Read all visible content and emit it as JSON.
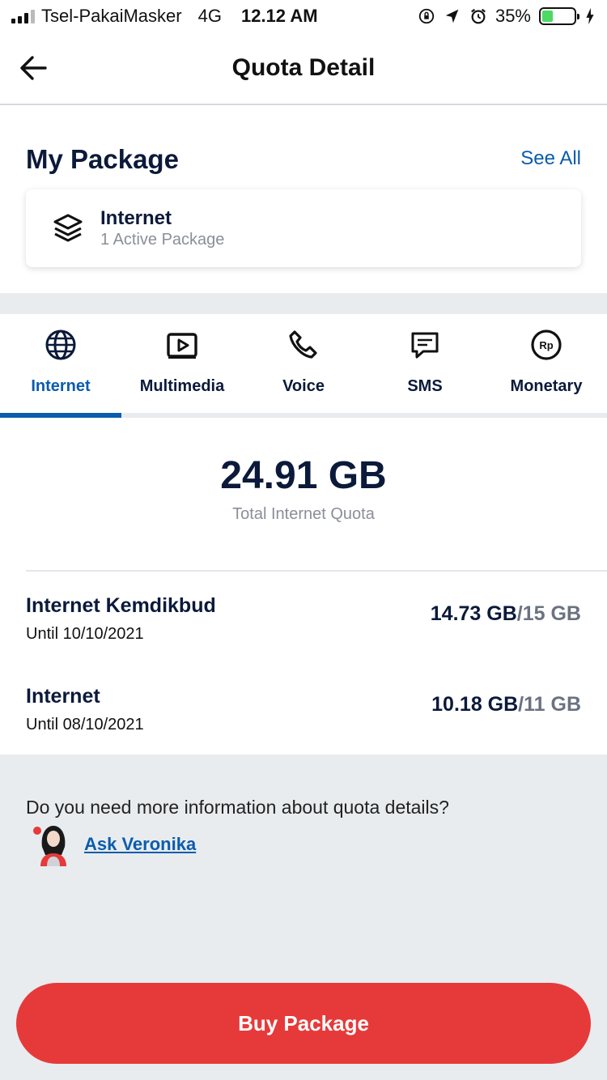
{
  "status_bar": {
    "carrier": "Tsel-PakaiMasker",
    "network": "4G",
    "time": "12.12 AM",
    "battery": "35%",
    "battery_level": 0.35
  },
  "header": {
    "title": "Quota Detail"
  },
  "my_package": {
    "title": "My Package",
    "see_all": "See All",
    "card": {
      "name": "Internet",
      "sub": "1 Active Package",
      "icon": "layers-icon"
    }
  },
  "tabs": [
    {
      "label": "Internet",
      "icon": "globe-icon",
      "active": true
    },
    {
      "label": "Multimedia",
      "icon": "play-icon",
      "active": false
    },
    {
      "label": "Voice",
      "icon": "phone-icon",
      "active": false
    },
    {
      "label": "SMS",
      "icon": "chat-icon",
      "active": false
    },
    {
      "label": "Monetary",
      "icon": "rupiah-icon",
      "active": false
    }
  ],
  "quota": {
    "total_value": "24.91 GB",
    "total_label": "Total Internet Quota",
    "items": [
      {
        "name": "Internet Kemdikbud",
        "until": "Until 10/10/2021",
        "used": "14.73 GB",
        "sep": "/",
        "total": "15 GB"
      },
      {
        "name": "Internet",
        "until": "Until 08/10/2021",
        "used": "10.18 GB",
        "sep": "/",
        "total": "11 GB"
      }
    ]
  },
  "info": {
    "question": "Do you need more information about quota details?",
    "ask_link": "Ask Veronika"
  },
  "buy_button": "Buy Package",
  "colors": {
    "accent": "#0b5cad",
    "primary_text": "#0b1a3a",
    "buy": "#e63a3a",
    "battery": "#4cd964"
  }
}
